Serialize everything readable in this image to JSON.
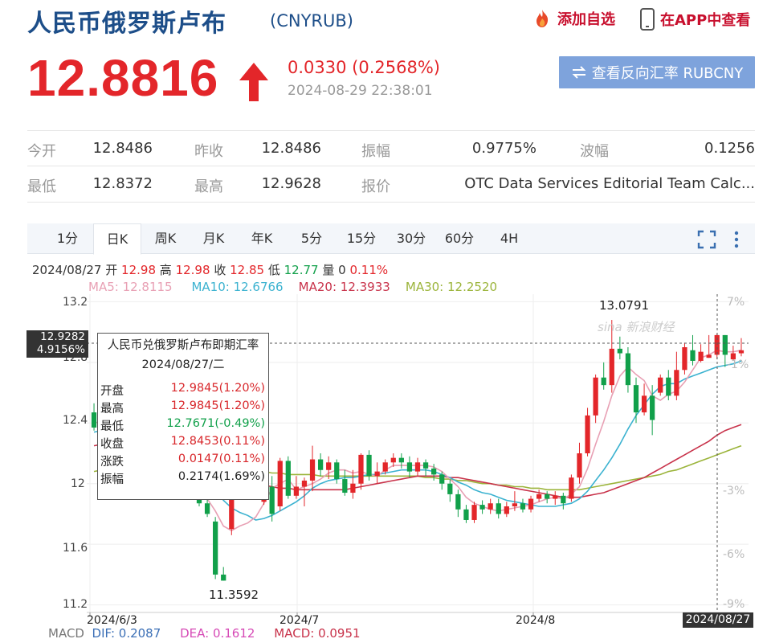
{
  "header": {
    "title": "人民币俄罗斯卢布",
    "code": "(CNYRUB)",
    "favorite_label": "添加自选",
    "app_label": "在APP中查看"
  },
  "quote": {
    "price": "12.8816",
    "change": "0.0330 (0.2568%)",
    "time": "2024-08-29 22:38:01",
    "reverse_label": "查看反向汇率 RUBCNY"
  },
  "stats": {
    "open_label": "今开",
    "open": "12.8486",
    "prev_label": "昨收",
    "prev": "12.8486",
    "amp_label": "振幅",
    "amp": "0.9775%",
    "wave_label": "波幅",
    "wave": "0.1256",
    "low_label": "最低",
    "low": "12.8372",
    "high_label": "最高",
    "high": "12.9628",
    "src_label": "报价",
    "src": "OTC Data Services Editorial Team Calc..."
  },
  "tabs": [
    "1分",
    "日K",
    "周K",
    "月K",
    "年K",
    "5分",
    "15分",
    "30分",
    "60分",
    "4H"
  ],
  "ohlc": {
    "date": "2024/08/27",
    "open_label": "开",
    "open": "12.98",
    "high_label": "高",
    "high": "12.98",
    "close_label": "收",
    "close": "12.85",
    "low_label": "低",
    "low": "12.77",
    "vol_label": "量",
    "vol": "0",
    "pct": "0.11%"
  },
  "ma": {
    "ma5": "MA5: 12.8115",
    "ma10": "MA10: 12.6766",
    "ma20": "MA20: 12.3933",
    "ma30": "MA30: 12.2520"
  },
  "axis": {
    "y_left": [
      "13.2",
      "12.8",
      "12.4",
      "12",
      "11.6",
      "11.2"
    ],
    "y_right": [
      "7%",
      "3%",
      "-1%",
      "-3%",
      "-6%",
      "-9%"
    ],
    "x": [
      "2024/6/3",
      "2024/7",
      "2024/8"
    ],
    "cross_price": "12.9282",
    "cross_pct": "4.9156%",
    "cross_date": "2024/08/27",
    "high_annot": "13.0791",
    "low_annot": "11.3592",
    "watermark": "sina 新浪财经"
  },
  "tooltip": {
    "title": "人民币兑俄罗斯卢布即期汇率",
    "date": "2024/08/27/二",
    "rows": [
      {
        "k": "开盘",
        "v": "12.9845(1.20%)",
        "c": "#d8272b"
      },
      {
        "k": "最高",
        "v": "12.9845(1.20%)",
        "c": "#d8272b"
      },
      {
        "k": "最低",
        "v": "12.7671(-0.49%)",
        "c": "#11a04a"
      },
      {
        "k": "收盘",
        "v": "12.8453(0.11%)",
        "c": "#d8272b"
      },
      {
        "k": "涨跌",
        "v": "0.0147(0.11%)",
        "c": "#d8272b"
      },
      {
        "k": "振幅",
        "v": "0.2174(1.69%)",
        "c": "#222222"
      }
    ]
  },
  "macd": {
    "label": "MACD",
    "dif": "DIF: 0.2087",
    "dea": "DEA: 0.1612",
    "macd": "MACD: 0.0951"
  },
  "colors": {
    "up": "#e3262a",
    "down": "#11a04a",
    "ma5": "#e8a0b4",
    "ma10": "#3bb2d0",
    "ma20": "#c8324a",
    "ma30": "#9bb43a"
  },
  "chart_data": {
    "type": "candlestick",
    "candles": [
      [
        12.47,
        12.37,
        12.53,
        12.35
      ],
      [
        12.41,
        12.46,
        12.49,
        12.38
      ],
      [
        12.44,
        12.38,
        12.47,
        12.36
      ],
      [
        12.39,
        12.3,
        12.41,
        12.28
      ],
      [
        12.31,
        12.31,
        12.33,
        12.28
      ],
      [
        12.3,
        12.3,
        12.32,
        12.28
      ],
      [
        12.3,
        12.27,
        12.31,
        12.25
      ],
      [
        12.27,
        12.22,
        12.29,
        12.2
      ],
      [
        12.22,
        12.2,
        12.24,
        12.18
      ],
      [
        12.2,
        12.1,
        12.22,
        12.08
      ],
      [
        12.1,
        12.02,
        12.12,
        12.0
      ],
      [
        12.02,
        11.98,
        12.05,
        11.95
      ],
      [
        11.98,
        11.93,
        12.01,
        11.91
      ],
      [
        11.93,
        11.87,
        11.98,
        11.85
      ],
      [
        11.87,
        11.8,
        11.92,
        11.78
      ],
      [
        11.75,
        11.4,
        11.78,
        11.37
      ],
      [
        11.4,
        11.36,
        11.45,
        11.36
      ],
      [
        11.7,
        11.95,
        11.98,
        11.66
      ],
      [
        11.95,
        12.1,
        12.12,
        11.92
      ],
      [
        12.1,
        12.05,
        12.2,
        12.02
      ],
      [
        12.05,
        12.0,
        12.15,
        11.98
      ],
      [
        11.88,
        11.98,
        12.0,
        11.86
      ],
      [
        11.98,
        11.8,
        12.05,
        11.75
      ],
      [
        11.85,
        12.15,
        12.17,
        11.82
      ],
      [
        12.15,
        11.92,
        12.18,
        11.9
      ],
      [
        11.92,
        11.98,
        12.05,
        11.9
      ],
      [
        11.98,
        12.02,
        12.04,
        11.85
      ],
      [
        12.02,
        12.16,
        12.25,
        11.95
      ],
      [
        12.16,
        12.09,
        12.2,
        12.05
      ],
      [
        12.09,
        12.14,
        12.18,
        12.03
      ],
      [
        12.14,
        12.03,
        12.16,
        12.0
      ],
      [
        12.03,
        11.94,
        12.09,
        11.92
      ],
      [
        11.94,
        12.0,
        12.09,
        11.9
      ],
      [
        12.0,
        12.19,
        12.2,
        11.96
      ],
      [
        12.19,
        12.05,
        12.22,
        12.02
      ],
      [
        12.05,
        12.08,
        12.14,
        12.0
      ],
      [
        12.08,
        12.14,
        12.16,
        12.06
      ],
      [
        12.14,
        12.17,
        12.2,
        12.11
      ],
      [
        12.17,
        12.14,
        12.2,
        12.1
      ],
      [
        12.14,
        12.08,
        12.18,
        12.04
      ],
      [
        12.08,
        12.14,
        12.17,
        12.05
      ],
      [
        12.14,
        12.1,
        12.16,
        12.05
      ],
      [
        12.1,
        12.06,
        12.13,
        12.02
      ],
      [
        12.06,
        12.0,
        12.08,
        11.96
      ],
      [
        12.0,
        11.93,
        12.03,
        11.88
      ],
      [
        11.93,
        11.83,
        11.96,
        11.78
      ],
      [
        11.83,
        11.76,
        11.86,
        11.74
      ],
      [
        11.76,
        11.86,
        11.88,
        11.74
      ],
      [
        11.86,
        11.83,
        11.89,
        11.8
      ],
      [
        11.83,
        11.87,
        11.9,
        11.8
      ],
      [
        11.87,
        11.8,
        11.9,
        11.77
      ],
      [
        11.8,
        11.85,
        11.88,
        11.78
      ],
      [
        11.85,
        11.87,
        11.95,
        11.82
      ],
      [
        11.87,
        11.83,
        11.9,
        11.81
      ],
      [
        11.83,
        11.9,
        11.92,
        11.81
      ],
      [
        11.9,
        11.93,
        11.96,
        11.88
      ],
      [
        11.93,
        11.9,
        11.95,
        11.87
      ],
      [
        11.9,
        11.92,
        11.95,
        11.86
      ],
      [
        11.92,
        11.87,
        11.94,
        11.83
      ],
      [
        11.9,
        12.04,
        12.06,
        11.88
      ],
      [
        12.04,
        12.2,
        12.27,
        12.0
      ],
      [
        12.2,
        12.45,
        12.5,
        12.18
      ],
      [
        12.45,
        12.7,
        12.72,
        12.4
      ],
      [
        12.7,
        12.65,
        12.8,
        12.62
      ],
      [
        12.65,
        12.89,
        13.08,
        12.6
      ],
      [
        12.89,
        12.86,
        12.97,
        12.82
      ],
      [
        12.86,
        12.65,
        12.9,
        12.6
      ],
      [
        12.65,
        12.47,
        12.7,
        12.4
      ],
      [
        12.47,
        12.58,
        12.66,
        12.45
      ],
      [
        12.58,
        12.42,
        12.65,
        12.32
      ],
      [
        12.6,
        12.7,
        12.72,
        12.58
      ],
      [
        12.7,
        12.58,
        12.75,
        12.55
      ],
      [
        12.58,
        12.75,
        12.87,
        12.55
      ],
      [
        12.75,
        12.9,
        12.93,
        12.72
      ],
      [
        12.88,
        12.81,
        12.98,
        12.78
      ],
      [
        12.81,
        12.87,
        12.92,
        12.8
      ],
      [
        12.83,
        12.85,
        12.98,
        12.83
      ],
      [
        12.85,
        12.98,
        12.99,
        12.82
      ],
      [
        12.98,
        12.85,
        12.98,
        12.77
      ],
      [
        12.82,
        12.86,
        12.91,
        12.81
      ],
      [
        12.86,
        12.88,
        12.96,
        12.84
      ]
    ],
    "ma5": [
      12.4,
      12.41,
      12.41,
      12.4,
      12.38,
      12.34,
      12.3,
      12.26,
      12.23,
      12.2,
      12.14,
      12.06,
      12.0,
      11.95,
      11.9,
      11.82,
      11.72,
      11.69,
      11.72,
      11.74,
      11.78,
      11.87,
      11.97,
      12.0,
      12.03,
      11.96,
      11.98,
      12.0,
      12.03,
      12.07,
      12.09,
      12.09,
      12.07,
      12.08,
      12.06,
      12.05,
      12.09,
      12.12,
      12.12,
      12.12,
      12.12,
      12.12,
      12.11,
      12.08,
      12.03,
      11.98,
      11.91,
      11.87,
      11.85,
      11.83,
      11.82,
      11.83,
      11.84,
      11.85,
      11.86,
      11.88,
      11.9,
      11.91,
      11.9,
      11.93,
      11.98,
      12.1,
      12.26,
      12.41,
      12.58,
      12.71,
      12.77,
      12.72,
      12.68,
      12.58,
      12.55,
      12.59,
      12.61,
      12.67,
      12.75,
      12.83,
      12.85,
      12.88,
      12.87,
      12.87,
      12.88
    ],
    "ma10": [
      12.34,
      12.35,
      12.36,
      12.36,
      12.36,
      12.35,
      12.33,
      12.31,
      12.29,
      12.27,
      12.22,
      12.16,
      12.11,
      12.07,
      12.02,
      11.96,
      11.89,
      11.84,
      11.81,
      11.79,
      11.76,
      11.77,
      11.79,
      11.82,
      11.85,
      11.88,
      11.92,
      11.97,
      12.0,
      12.02,
      12.03,
      12.04,
      12.04,
      12.05,
      12.06,
      12.06,
      12.07,
      12.08,
      12.09,
      12.09,
      12.09,
      12.09,
      12.08,
      12.06,
      12.04,
      12.01,
      11.99,
      11.96,
      11.94,
      11.93,
      11.91,
      11.89,
      11.88,
      11.87,
      11.86,
      11.85,
      11.85,
      11.85,
      11.86,
      11.87,
      11.9,
      11.95,
      12.02,
      12.09,
      12.17,
      12.26,
      12.36,
      12.45,
      12.52,
      12.59,
      12.64,
      12.66,
      12.66,
      12.69,
      12.71,
      12.73,
      12.75,
      12.77,
      12.78,
      12.79,
      12.81
    ],
    "ma20": [
      12.25,
      12.26,
      12.27,
      12.28,
      12.29,
      12.3,
      12.3,
      12.3,
      12.29,
      12.28,
      12.27,
      12.25,
      12.23,
      12.21,
      12.19,
      12.16,
      12.12,
      12.09,
      12.06,
      12.04,
      12.01,
      11.99,
      11.98,
      11.97,
      11.97,
      11.96,
      11.96,
      11.96,
      11.96,
      11.96,
      11.96,
      11.96,
      11.97,
      11.98,
      11.99,
      12.0,
      12.01,
      12.02,
      12.03,
      12.04,
      12.05,
      12.05,
      12.05,
      12.05,
      12.04,
      12.04,
      12.03,
      12.02,
      12.01,
      12.0,
      11.99,
      11.98,
      11.97,
      11.96,
      11.95,
      11.94,
      11.93,
      11.92,
      11.91,
      11.91,
      11.91,
      11.92,
      11.93,
      11.94,
      11.96,
      11.98,
      12.0,
      12.02,
      12.04,
      12.07,
      12.1,
      12.13,
      12.16,
      12.19,
      12.22,
      12.25,
      12.28,
      12.32,
      12.35,
      12.37,
      12.39
    ],
    "ma30": [
      12.08,
      12.09,
      12.1,
      12.11,
      12.12,
      12.13,
      12.14,
      12.15,
      12.16,
      12.16,
      12.16,
      12.16,
      12.16,
      12.15,
      12.14,
      12.13,
      12.12,
      12.11,
      12.1,
      12.09,
      12.08,
      12.08,
      12.07,
      12.07,
      12.06,
      12.06,
      12.06,
      12.06,
      12.05,
      12.05,
      12.05,
      12.05,
      12.05,
      12.05,
      12.05,
      12.05,
      12.05,
      12.05,
      12.05,
      12.05,
      12.05,
      12.04,
      12.04,
      12.03,
      12.03,
      12.02,
      12.02,
      12.01,
      12.0,
      12.0,
      11.99,
      11.99,
      11.98,
      11.98,
      11.97,
      11.97,
      11.96,
      11.96,
      11.96,
      11.96,
      11.96,
      11.97,
      11.98,
      11.99,
      12.0,
      12.01,
      12.02,
      12.03,
      12.04,
      12.05,
      12.06,
      12.08,
      12.09,
      12.11,
      12.13,
      12.15,
      12.17,
      12.19,
      12.21,
      12.23,
      12.25
    ],
    "ylim": [
      11.15,
      13.25
    ]
  }
}
